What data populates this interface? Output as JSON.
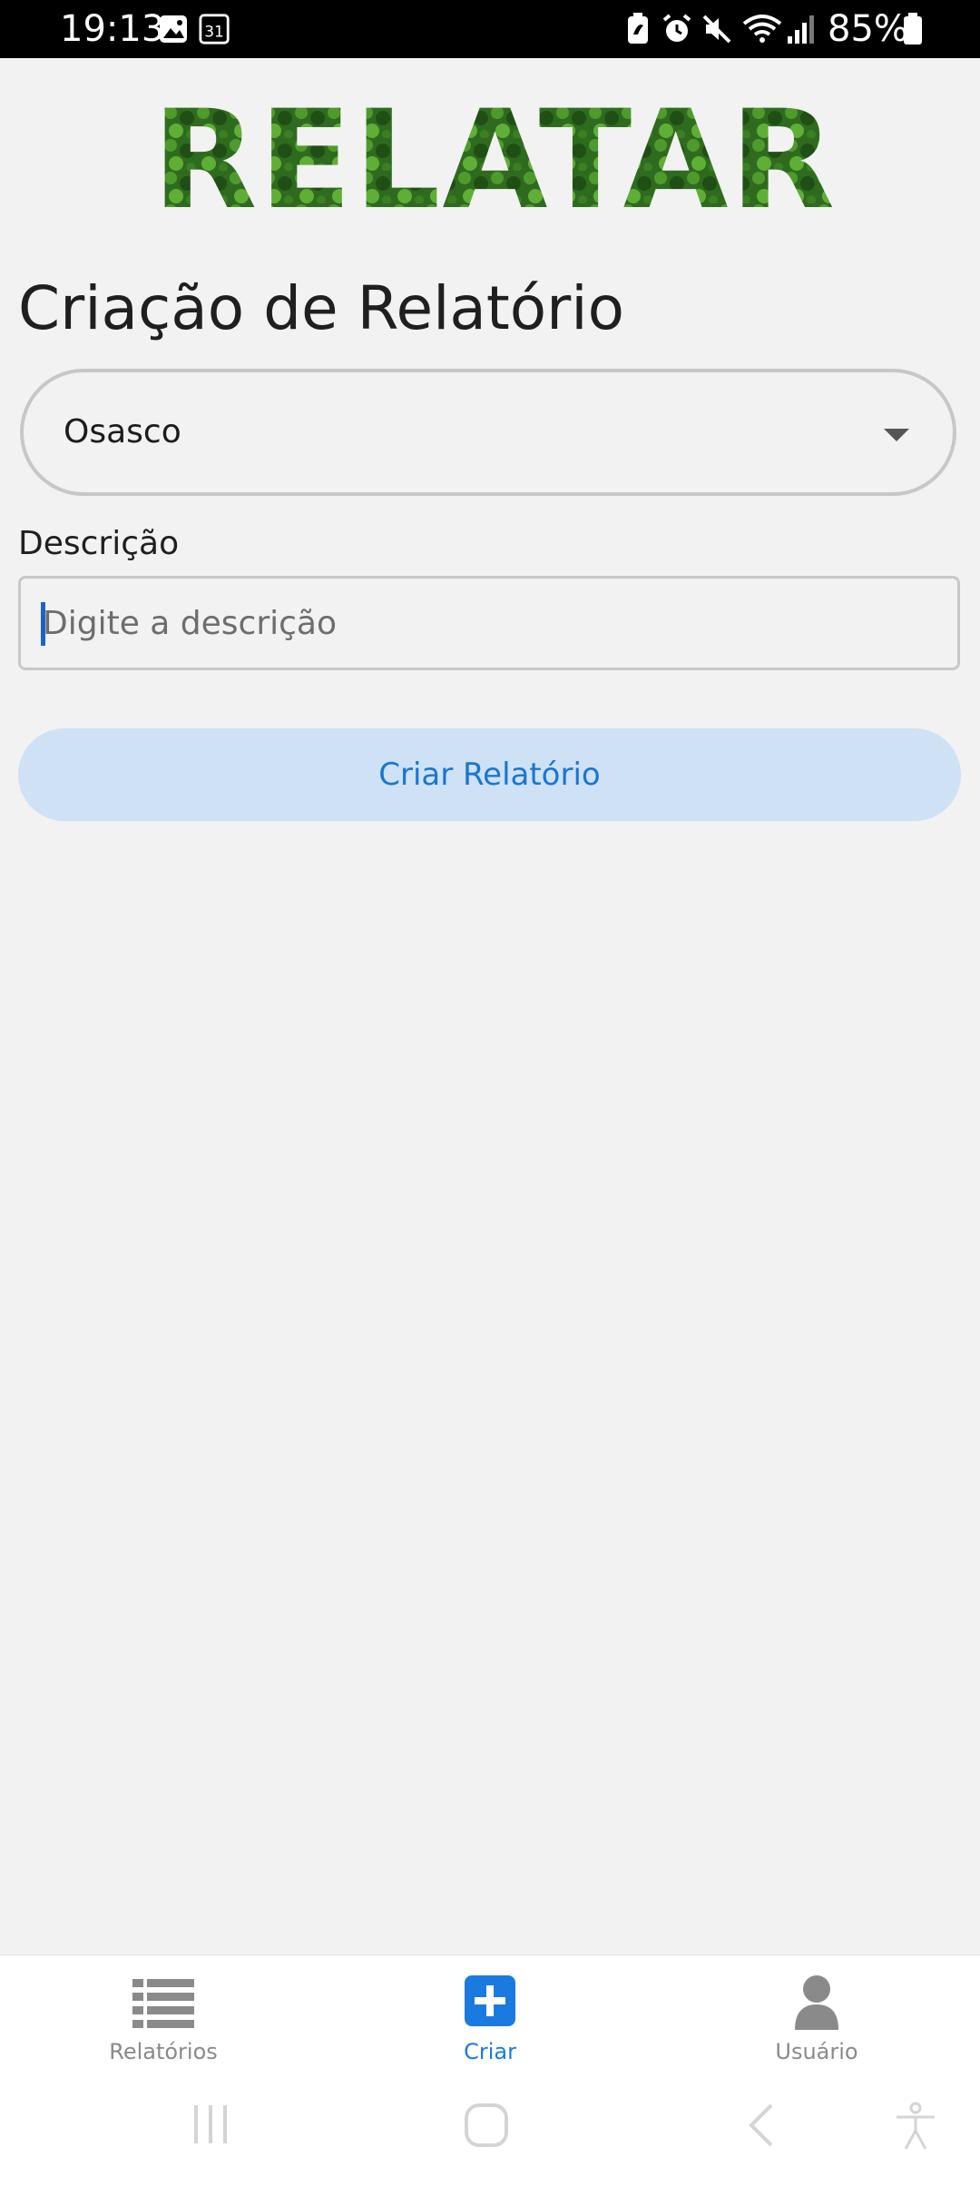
{
  "status_bar": {
    "time": "19:13",
    "battery_percent": "85%",
    "left_icons": [
      "gallery-icon",
      "calendar-icon"
    ],
    "calendar_day": "31",
    "right_icons": [
      "battery-saver-icon",
      "alarm-icon",
      "mute-icon",
      "wifi-icon",
      "signal-icon",
      "battery-icon"
    ]
  },
  "app": {
    "logo_text": "RELATAR",
    "logo_color": "#2e7d32"
  },
  "form": {
    "title": "Criação de Relatório",
    "city_select": {
      "value": "Osasco"
    },
    "description": {
      "label": "Descrição",
      "placeholder": "Digite a descrição",
      "value": ""
    },
    "submit_label": "Criar Relatório"
  },
  "bottom_nav": {
    "items": [
      {
        "label": "Relatórios",
        "icon": "list-icon",
        "active": false
      },
      {
        "label": "Criar",
        "icon": "plus-square-icon",
        "active": true
      },
      {
        "label": "Usuário",
        "icon": "user-icon",
        "active": false
      }
    ],
    "active_color": "#1a7ae0",
    "inactive_color": "#8a8a8a"
  },
  "system_nav": {
    "icons": [
      "recents-icon",
      "home-icon",
      "back-icon",
      "accessibility-icon"
    ]
  }
}
